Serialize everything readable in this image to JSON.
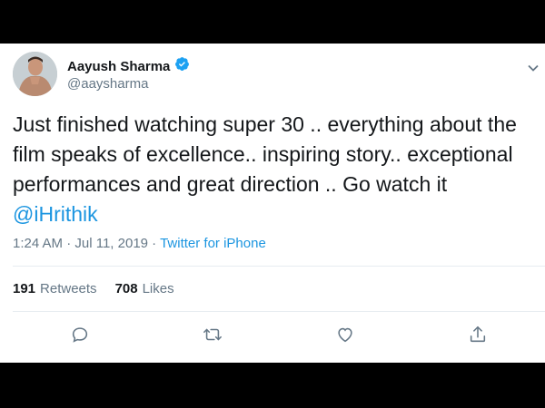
{
  "user": {
    "name": "Aayush Sharma",
    "handle": "@aaysharma",
    "verified": true
  },
  "tweet": {
    "text": "Just finished watching super 30 .. everything about the film speaks of excellence.. inspiring story..  exceptional performances and great direction ..  Go watch it",
    "mention": "@iHrithik"
  },
  "meta": {
    "time": "1:24 AM",
    "separator1": " · ",
    "date": "Jul 11, 2019",
    "separator2": " · ",
    "source": "Twitter for iPhone"
  },
  "stats": {
    "retweets_count": "191",
    "retweets_label": "Retweets",
    "likes_count": "708",
    "likes_label": "Likes"
  },
  "icons": {
    "reply": "reply-icon",
    "retweet": "retweet-icon",
    "like": "heart-icon",
    "share": "share-icon",
    "verified": "verified-badge-icon",
    "more": "chevron-down-icon"
  },
  "colors": {
    "link": "#1b95e0",
    "text": "#14171a",
    "secondary": "#657786",
    "divider": "#e6ecf0"
  }
}
